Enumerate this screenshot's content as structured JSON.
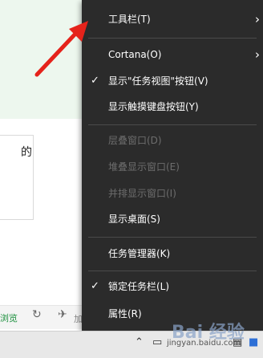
{
  "background": {
    "card_text": "的",
    "toolbar_green_text": "浏览",
    "toolbar_gray_text": "加"
  },
  "context_menu": {
    "items": [
      {
        "label": "工具栏(T)",
        "submenu": true
      },
      {
        "label": "Cortana(O)",
        "submenu": true
      },
      {
        "label": "显示\"任务视图\"按钮(V)",
        "checked": true
      },
      {
        "label": "显示触摸键盘按钮(Y)"
      },
      {
        "label": "层叠窗口(D)",
        "disabled": true
      },
      {
        "label": "堆叠显示窗口(E)",
        "disabled": true
      },
      {
        "label": "并排显示窗口(I)",
        "disabled": true
      },
      {
        "label": "显示桌面(S)"
      },
      {
        "label": "任务管理器(K)"
      },
      {
        "label": "锁定任务栏(L)",
        "checked": true
      },
      {
        "label": "属性(R)"
      }
    ],
    "chevron_glyph": "›",
    "check_glyph": "✓"
  },
  "taskbar": {
    "tray_text": "jingyan.baidu.com"
  },
  "watermark": {
    "text": "Bai 经验"
  },
  "colors": {
    "menu_bg": "#2b2b2b",
    "arrow": "#e5231b",
    "disabled_text": "#6d6d6d"
  }
}
